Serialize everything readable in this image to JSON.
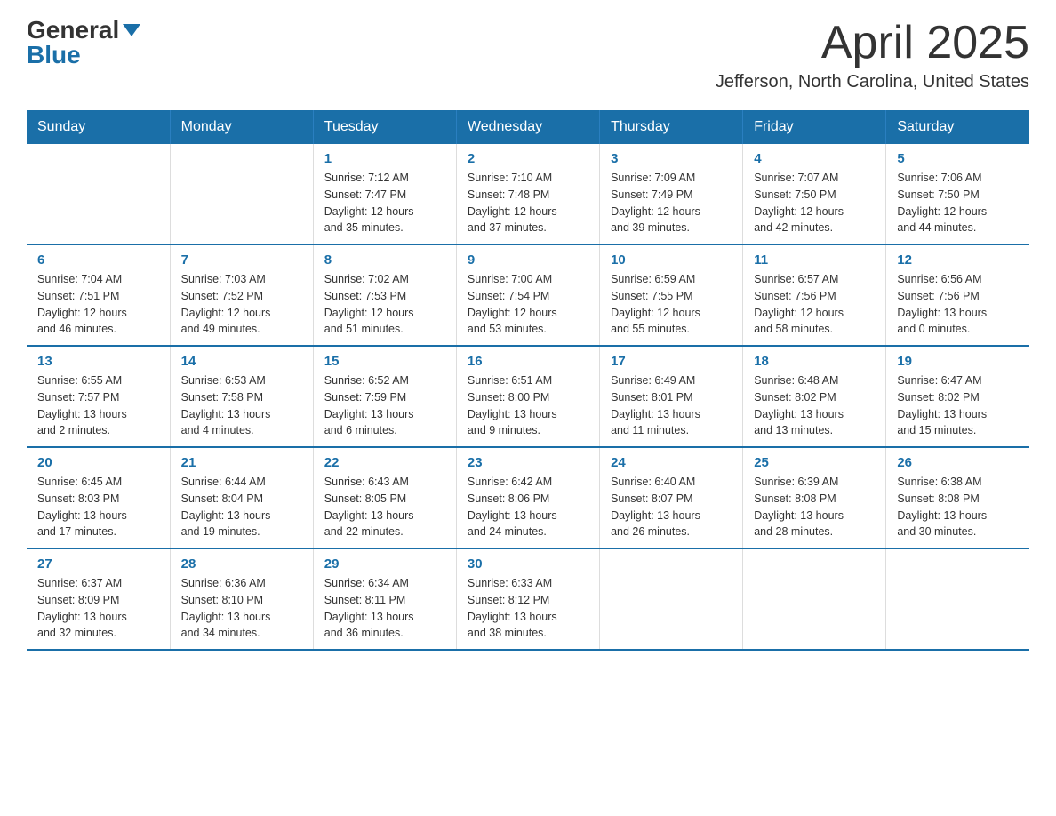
{
  "header": {
    "logo_general": "General",
    "logo_blue": "Blue",
    "month": "April 2025",
    "location": "Jefferson, North Carolina, United States"
  },
  "weekdays": [
    "Sunday",
    "Monday",
    "Tuesday",
    "Wednesday",
    "Thursday",
    "Friday",
    "Saturday"
  ],
  "weeks": [
    [
      {
        "day": "",
        "info": ""
      },
      {
        "day": "",
        "info": ""
      },
      {
        "day": "1",
        "info": "Sunrise: 7:12 AM\nSunset: 7:47 PM\nDaylight: 12 hours\nand 35 minutes."
      },
      {
        "day": "2",
        "info": "Sunrise: 7:10 AM\nSunset: 7:48 PM\nDaylight: 12 hours\nand 37 minutes."
      },
      {
        "day": "3",
        "info": "Sunrise: 7:09 AM\nSunset: 7:49 PM\nDaylight: 12 hours\nand 39 minutes."
      },
      {
        "day": "4",
        "info": "Sunrise: 7:07 AM\nSunset: 7:50 PM\nDaylight: 12 hours\nand 42 minutes."
      },
      {
        "day": "5",
        "info": "Sunrise: 7:06 AM\nSunset: 7:50 PM\nDaylight: 12 hours\nand 44 minutes."
      }
    ],
    [
      {
        "day": "6",
        "info": "Sunrise: 7:04 AM\nSunset: 7:51 PM\nDaylight: 12 hours\nand 46 minutes."
      },
      {
        "day": "7",
        "info": "Sunrise: 7:03 AM\nSunset: 7:52 PM\nDaylight: 12 hours\nand 49 minutes."
      },
      {
        "day": "8",
        "info": "Sunrise: 7:02 AM\nSunset: 7:53 PM\nDaylight: 12 hours\nand 51 minutes."
      },
      {
        "day": "9",
        "info": "Sunrise: 7:00 AM\nSunset: 7:54 PM\nDaylight: 12 hours\nand 53 minutes."
      },
      {
        "day": "10",
        "info": "Sunrise: 6:59 AM\nSunset: 7:55 PM\nDaylight: 12 hours\nand 55 minutes."
      },
      {
        "day": "11",
        "info": "Sunrise: 6:57 AM\nSunset: 7:56 PM\nDaylight: 12 hours\nand 58 minutes."
      },
      {
        "day": "12",
        "info": "Sunrise: 6:56 AM\nSunset: 7:56 PM\nDaylight: 13 hours\nand 0 minutes."
      }
    ],
    [
      {
        "day": "13",
        "info": "Sunrise: 6:55 AM\nSunset: 7:57 PM\nDaylight: 13 hours\nand 2 minutes."
      },
      {
        "day": "14",
        "info": "Sunrise: 6:53 AM\nSunset: 7:58 PM\nDaylight: 13 hours\nand 4 minutes."
      },
      {
        "day": "15",
        "info": "Sunrise: 6:52 AM\nSunset: 7:59 PM\nDaylight: 13 hours\nand 6 minutes."
      },
      {
        "day": "16",
        "info": "Sunrise: 6:51 AM\nSunset: 8:00 PM\nDaylight: 13 hours\nand 9 minutes."
      },
      {
        "day": "17",
        "info": "Sunrise: 6:49 AM\nSunset: 8:01 PM\nDaylight: 13 hours\nand 11 minutes."
      },
      {
        "day": "18",
        "info": "Sunrise: 6:48 AM\nSunset: 8:02 PM\nDaylight: 13 hours\nand 13 minutes."
      },
      {
        "day": "19",
        "info": "Sunrise: 6:47 AM\nSunset: 8:02 PM\nDaylight: 13 hours\nand 15 minutes."
      }
    ],
    [
      {
        "day": "20",
        "info": "Sunrise: 6:45 AM\nSunset: 8:03 PM\nDaylight: 13 hours\nand 17 minutes."
      },
      {
        "day": "21",
        "info": "Sunrise: 6:44 AM\nSunset: 8:04 PM\nDaylight: 13 hours\nand 19 minutes."
      },
      {
        "day": "22",
        "info": "Sunrise: 6:43 AM\nSunset: 8:05 PM\nDaylight: 13 hours\nand 22 minutes."
      },
      {
        "day": "23",
        "info": "Sunrise: 6:42 AM\nSunset: 8:06 PM\nDaylight: 13 hours\nand 24 minutes."
      },
      {
        "day": "24",
        "info": "Sunrise: 6:40 AM\nSunset: 8:07 PM\nDaylight: 13 hours\nand 26 minutes."
      },
      {
        "day": "25",
        "info": "Sunrise: 6:39 AM\nSunset: 8:08 PM\nDaylight: 13 hours\nand 28 minutes."
      },
      {
        "day": "26",
        "info": "Sunrise: 6:38 AM\nSunset: 8:08 PM\nDaylight: 13 hours\nand 30 minutes."
      }
    ],
    [
      {
        "day": "27",
        "info": "Sunrise: 6:37 AM\nSunset: 8:09 PM\nDaylight: 13 hours\nand 32 minutes."
      },
      {
        "day": "28",
        "info": "Sunrise: 6:36 AM\nSunset: 8:10 PM\nDaylight: 13 hours\nand 34 minutes."
      },
      {
        "day": "29",
        "info": "Sunrise: 6:34 AM\nSunset: 8:11 PM\nDaylight: 13 hours\nand 36 minutes."
      },
      {
        "day": "30",
        "info": "Sunrise: 6:33 AM\nSunset: 8:12 PM\nDaylight: 13 hours\nand 38 minutes."
      },
      {
        "day": "",
        "info": ""
      },
      {
        "day": "",
        "info": ""
      },
      {
        "day": "",
        "info": ""
      }
    ]
  ]
}
